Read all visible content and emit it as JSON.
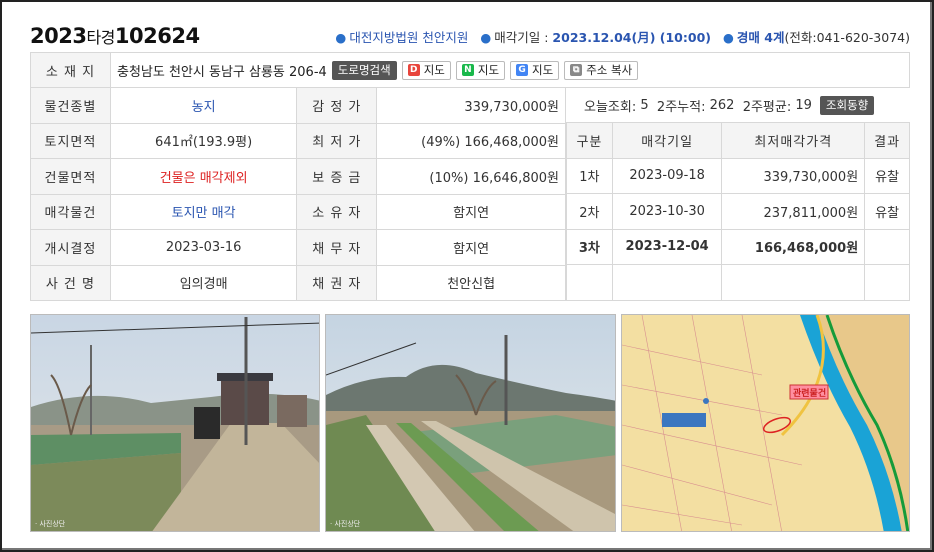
{
  "case": {
    "year": "2023",
    "type": "타경",
    "number": "102624"
  },
  "court": "대전지방법원 천안지원",
  "sale_date_label": "매각기일 : ",
  "sale_date": "2023.12.04(月) (10:00)",
  "dept": "경매 4계",
  "dept_phone": "(전화:041-620-3074)",
  "address": {
    "label": "소 재 지",
    "value": "충청남도 천안시 동남구 삼룡동 206-4",
    "buttons": [
      "도로명검색",
      "지도",
      "지도",
      "지도",
      "주소 복사"
    ],
    "icons": [
      "daum-icon",
      "naver-icon",
      "google-icon",
      "copy-icon"
    ]
  },
  "left_rows": [
    {
      "l1": "물건종별",
      "v1": "농지",
      "l2": "감 정 가",
      "v2": "339,730,000원"
    },
    {
      "l1": "토지면적",
      "v1": "641㎡(193.9평)",
      "l2": "최 저 가",
      "v2": "(49%) 166,468,000원"
    },
    {
      "l1": "건물면적",
      "v1": "건물은 매각제외",
      "l2": "보 증 금",
      "v2": "(10%) 16,646,800원"
    },
    {
      "l1": "매각물건",
      "v1": "토지만 매각",
      "l2": "소 유 자",
      "v2": "함지연"
    },
    {
      "l1": "개시결정",
      "v1": "2023-03-16",
      "l2": "채 무 자",
      "v2": "함지연"
    },
    {
      "l1": "사 건 명",
      "v1": "임의경매",
      "l2": "채 권 자",
      "v2": "천안신협"
    }
  ],
  "views": {
    "today_label": "오늘조회:",
    "today": "5",
    "two_week_label": "2주누적:",
    "two_week": "262",
    "avg_label": "2주평균:",
    "avg": "19",
    "button": "조회동향"
  },
  "history": {
    "headers": [
      "구분",
      "매각기일",
      "최저매각가격",
      "결과"
    ],
    "rows": [
      {
        "round": "1차",
        "date": "2023-09-18",
        "price": "339,730,000원",
        "result": "유찰"
      },
      {
        "round": "2차",
        "date": "2023-10-30",
        "price": "237,811,000원",
        "result": "유찰"
      },
      {
        "round": "3차",
        "date": "2023-12-04",
        "price": "166,468,000원",
        "result": ""
      }
    ]
  },
  "photos": {
    "map_label": "관련물건"
  },
  "colors": {
    "accent_blue": "#2a55b0",
    "red": "#d22222",
    "river": "#1aa3d6"
  }
}
